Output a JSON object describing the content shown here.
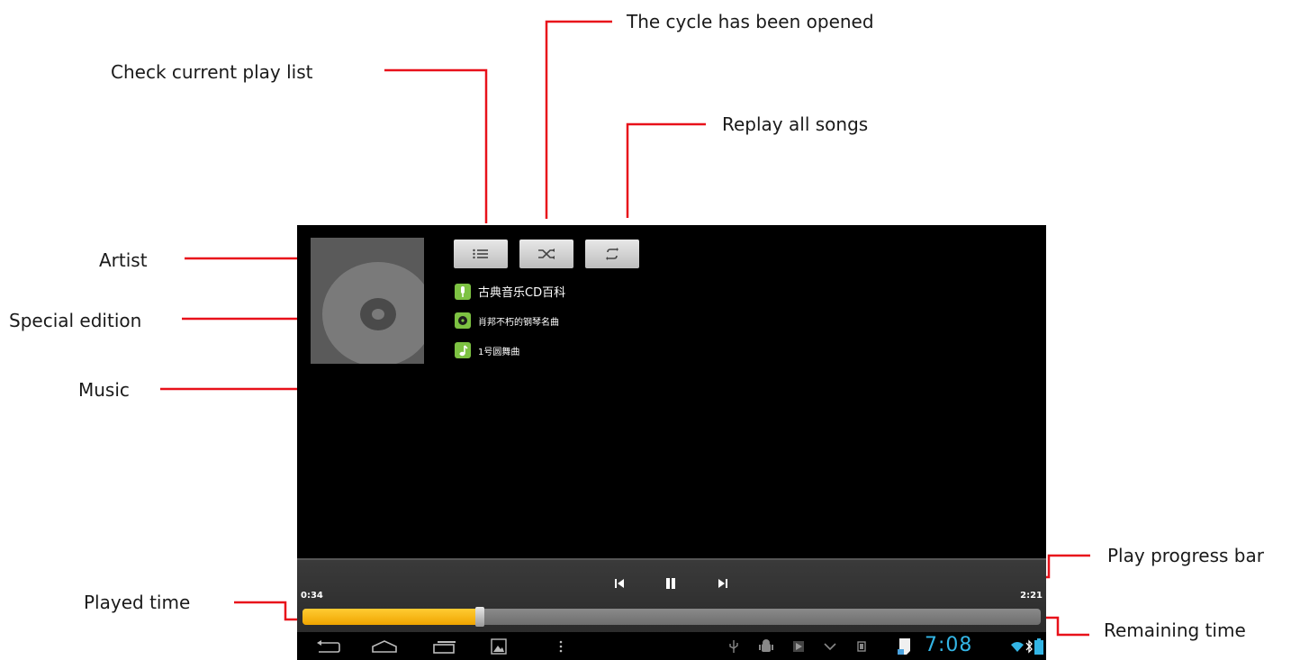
{
  "annotations": {
    "check_playlist": "Check current play list",
    "cycle_opened": "The cycle has been opened",
    "replay_all": "Replay all songs",
    "artist": "Artist",
    "special_edition": "Special edition",
    "music": "Music",
    "played_time": "Played time",
    "play_progress_bar": "Play progress bar",
    "remaining_time": "Remaining time"
  },
  "player": {
    "artist": "古典音乐CD百科",
    "album": "肖邦不朽的钢琴名曲",
    "track": "1号圆舞曲",
    "played_time": "0:34",
    "total_time": "2:21",
    "progress": 0.24
  },
  "statusbar": {
    "clock": "7:08"
  },
  "colors": {
    "accent_leader": "#e8111a",
    "progress_fill": "#f5b700",
    "info_icon": "#7dc242",
    "clock": "#33b5e5"
  },
  "icons": [
    "playlist-icon",
    "shuffle-icon",
    "repeat-icon",
    "artist-icon",
    "album-icon",
    "music-note-icon",
    "previous-icon",
    "pause-icon",
    "next-icon",
    "back-icon",
    "home-icon",
    "recent-apps-icon",
    "screenshot-icon",
    "menu-icon",
    "usb-icon",
    "android-icon",
    "media-icon",
    "chevron-down-icon",
    "device-icon",
    "sd-card-icon",
    "wifi-icon",
    "bluetooth-icon",
    "battery-icon"
  ]
}
